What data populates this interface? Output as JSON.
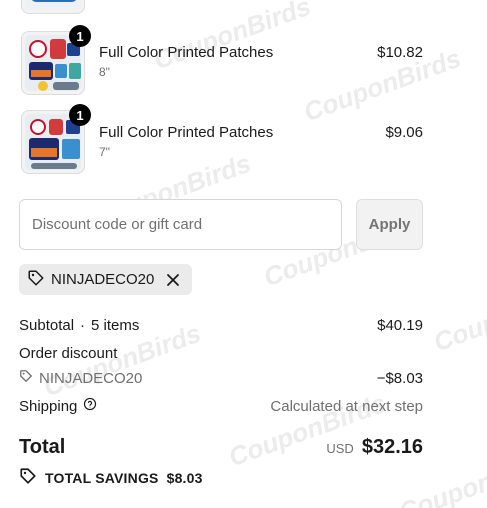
{
  "watermark_text": "CouponBirds",
  "items": [
    {
      "title": "Full Color Printed Patches",
      "variant": "8\"",
      "price": "$10.82",
      "quantity": "1"
    },
    {
      "title": "Full Color Printed Patches",
      "variant": "7\"",
      "price": "$9.06",
      "quantity": "1"
    }
  ],
  "discount": {
    "placeholder": "Discount code or gift card",
    "value": "",
    "apply_label": "Apply",
    "applied_code": "NINJADECO20"
  },
  "summary": {
    "subtotal_label": "Subtotal",
    "subtotal_separator": "·",
    "subtotal_items": "5 items",
    "subtotal_value": "$40.19",
    "order_discount_label": "Order discount",
    "discount_code": "NINJADECO20",
    "discount_value": "−$8.03",
    "shipping_label": "Shipping",
    "shipping_value": "Calculated at next step",
    "total_label": "Total",
    "currency": "USD",
    "total_value": "$32.16",
    "savings_label": "TOTAL SAVINGS",
    "savings_value": "$8.03"
  },
  "icons": {
    "tag": "tag-icon",
    "close": "close-icon",
    "help": "help-circle-icon",
    "savings": "price-tag-icon"
  },
  "colors": {
    "text": "#1a1a1a",
    "muted": "#707070",
    "badge": "#000000",
    "chip": "#ebebeb"
  }
}
